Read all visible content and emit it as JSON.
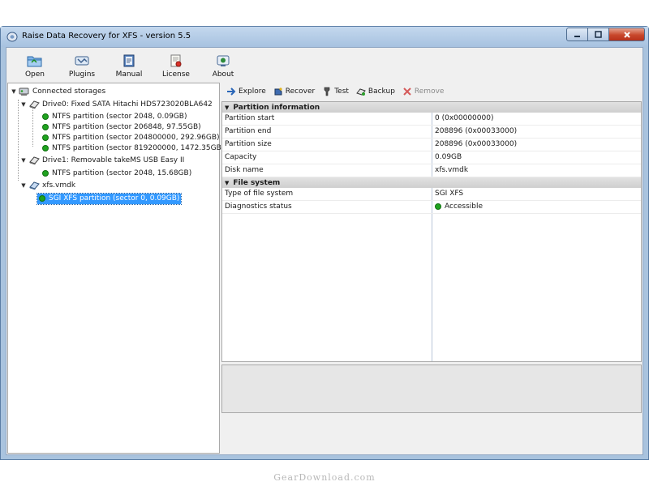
{
  "window": {
    "title": "Raise Data Recovery for XFS - version 5.5"
  },
  "toolbar": {
    "buttons": [
      {
        "label": "Open",
        "icon": "open-folder-icon"
      },
      {
        "label": "Plugins",
        "icon": "plugins-icon"
      },
      {
        "label": "Manual",
        "icon": "manual-book-icon"
      },
      {
        "label": "License",
        "icon": "license-icon"
      },
      {
        "label": "About",
        "icon": "about-icon"
      }
    ]
  },
  "tree": {
    "root": "Connected storages",
    "drive0": {
      "label": "Drive0: Fixed SATA Hitachi HDS723020BLA642",
      "partitions": [
        "NTFS partition (sector 2048, 0.09GB)",
        "NTFS partition (sector 206848, 97.55GB)",
        "NTFS partition (sector 204800000, 292.96GB)",
        "NTFS partition (sector 819200000, 1472.35GB)"
      ]
    },
    "drive1": {
      "label": "Drive1: Removable takeMS USB Easy II",
      "partitions": [
        "NTFS partition (sector 2048, 15.68GB)"
      ]
    },
    "image": {
      "label": "xfs.vmdk",
      "partitions": [
        "SGI XFS partition (sector 0, 0.09GB)"
      ]
    }
  },
  "actions": {
    "explore": "Explore",
    "recover": "Recover",
    "test": "Test",
    "backup": "Backup",
    "remove": "Remove"
  },
  "properties": {
    "partition_info": {
      "title": "Partition information",
      "rows": [
        {
          "key": "Partition start",
          "value": "0 (0x00000000)"
        },
        {
          "key": "Partition end",
          "value": "208896 (0x00033000)"
        },
        {
          "key": "Partition size",
          "value": "208896 (0x00033000)"
        },
        {
          "key": "Capacity",
          "value": "0.09GB"
        },
        {
          "key": "Disk name",
          "value": "xfs.vmdk"
        }
      ]
    },
    "file_system": {
      "title": "File system",
      "rows": [
        {
          "key": "Type of file system",
          "value": "SGI XFS"
        },
        {
          "key": "Diagnostics status",
          "value": "Accessible"
        }
      ]
    }
  },
  "colors": {
    "status_ok": "#1fa31f",
    "selection": "#3399ff"
  },
  "watermark": "GearDownload.com"
}
